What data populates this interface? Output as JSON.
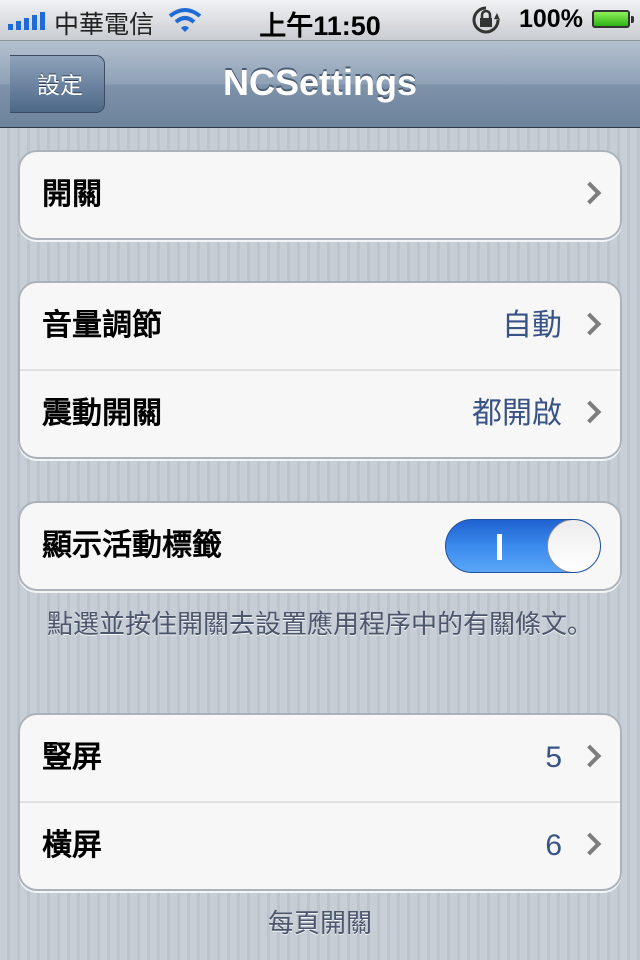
{
  "status_bar": {
    "carrier": "中華電信",
    "time": "上午11:50",
    "battery": "100%",
    "signal_icon": "signal-bars-icon",
    "wifi_icon": "wifi-icon",
    "lock_icon": "rotation-lock-icon",
    "battery_icon": "battery-icon"
  },
  "navbar": {
    "back_label": "設定",
    "title": "NCSettings"
  },
  "groups": {
    "switches": {
      "label": "開關"
    },
    "sound": {
      "volume_label": "音量調節",
      "volume_value": "自動",
      "vibrate_label": "震動開關",
      "vibrate_value": "都開啟"
    },
    "badge": {
      "label": "顯示活動標籤",
      "toggle_on": true,
      "toggle_text": "I",
      "note": "點選並按住開關去設置應用程序中的有關條文。"
    },
    "per_page": {
      "portrait_label": "豎屏",
      "portrait_value": "5",
      "landscape_label": "橫屏",
      "landscape_value": "6",
      "footer": "每頁開關"
    }
  },
  "colors": {
    "accent_value": "#385487",
    "toggle_on": "#3e8ef0",
    "nav_bar": "#8fa1b6"
  }
}
